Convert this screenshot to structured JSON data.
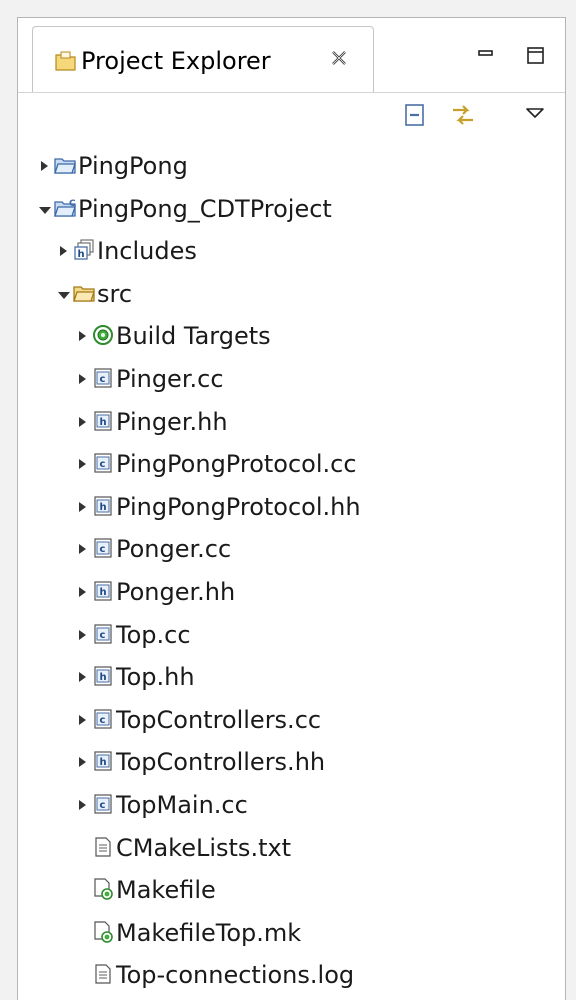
{
  "tab": {
    "title": "Project Explorer",
    "icon": "project-explorer-icon"
  },
  "window_controls": {
    "minimize": "minimize-icon",
    "maximize": "maximize-icon"
  },
  "toolbar": {
    "collapse_all": "collapse-all-icon",
    "link_with_editor": "link-with-editor-icon",
    "view_menu": "view-menu-icon"
  },
  "tree": [
    {
      "label": "PingPong",
      "icon": "folder-icon",
      "level": 0,
      "twisty": "collapsed"
    },
    {
      "label": "PingPong_CDTProject",
      "icon": "cdt-project-icon",
      "level": 0,
      "twisty": "expanded"
    },
    {
      "label": "Includes",
      "icon": "includes-icon",
      "level": 1,
      "twisty": "collapsed"
    },
    {
      "label": "src",
      "icon": "source-folder-icon",
      "level": 1,
      "twisty": "expanded"
    },
    {
      "label": "Build Targets",
      "icon": "build-targets-icon",
      "level": 2,
      "twisty": "collapsed"
    },
    {
      "label": "Pinger.cc",
      "icon": "c-source-file-icon",
      "level": 2,
      "twisty": "collapsed"
    },
    {
      "label": "Pinger.hh",
      "icon": "header-file-icon",
      "level": 2,
      "twisty": "collapsed"
    },
    {
      "label": "PingPongProtocol.cc",
      "icon": "c-source-file-icon",
      "level": 2,
      "twisty": "collapsed"
    },
    {
      "label": "PingPongProtocol.hh",
      "icon": "header-file-icon",
      "level": 2,
      "twisty": "collapsed"
    },
    {
      "label": "Ponger.cc",
      "icon": "c-source-file-icon",
      "level": 2,
      "twisty": "collapsed"
    },
    {
      "label": "Ponger.hh",
      "icon": "header-file-icon",
      "level": 2,
      "twisty": "collapsed"
    },
    {
      "label": "Top.cc",
      "icon": "c-source-file-icon",
      "level": 2,
      "twisty": "collapsed"
    },
    {
      "label": "Top.hh",
      "icon": "header-file-icon",
      "level": 2,
      "twisty": "collapsed"
    },
    {
      "label": "TopControllers.cc",
      "icon": "c-source-file-icon",
      "level": 2,
      "twisty": "collapsed"
    },
    {
      "label": "TopControllers.hh",
      "icon": "header-file-icon",
      "level": 2,
      "twisty": "collapsed"
    },
    {
      "label": "TopMain.cc",
      "icon": "c-source-file-icon",
      "level": 2,
      "twisty": "collapsed"
    },
    {
      "label": "CMakeLists.txt",
      "icon": "text-file-icon",
      "level": 2,
      "twisty": "none"
    },
    {
      "label": "Makefile",
      "icon": "makefile-icon",
      "level": 2,
      "twisty": "none"
    },
    {
      "label": "MakefileTop.mk",
      "icon": "makefile-icon",
      "level": 2,
      "twisty": "none"
    },
    {
      "label": "Top-connections.log",
      "icon": "text-file-icon",
      "level": 2,
      "twisty": "none"
    }
  ]
}
